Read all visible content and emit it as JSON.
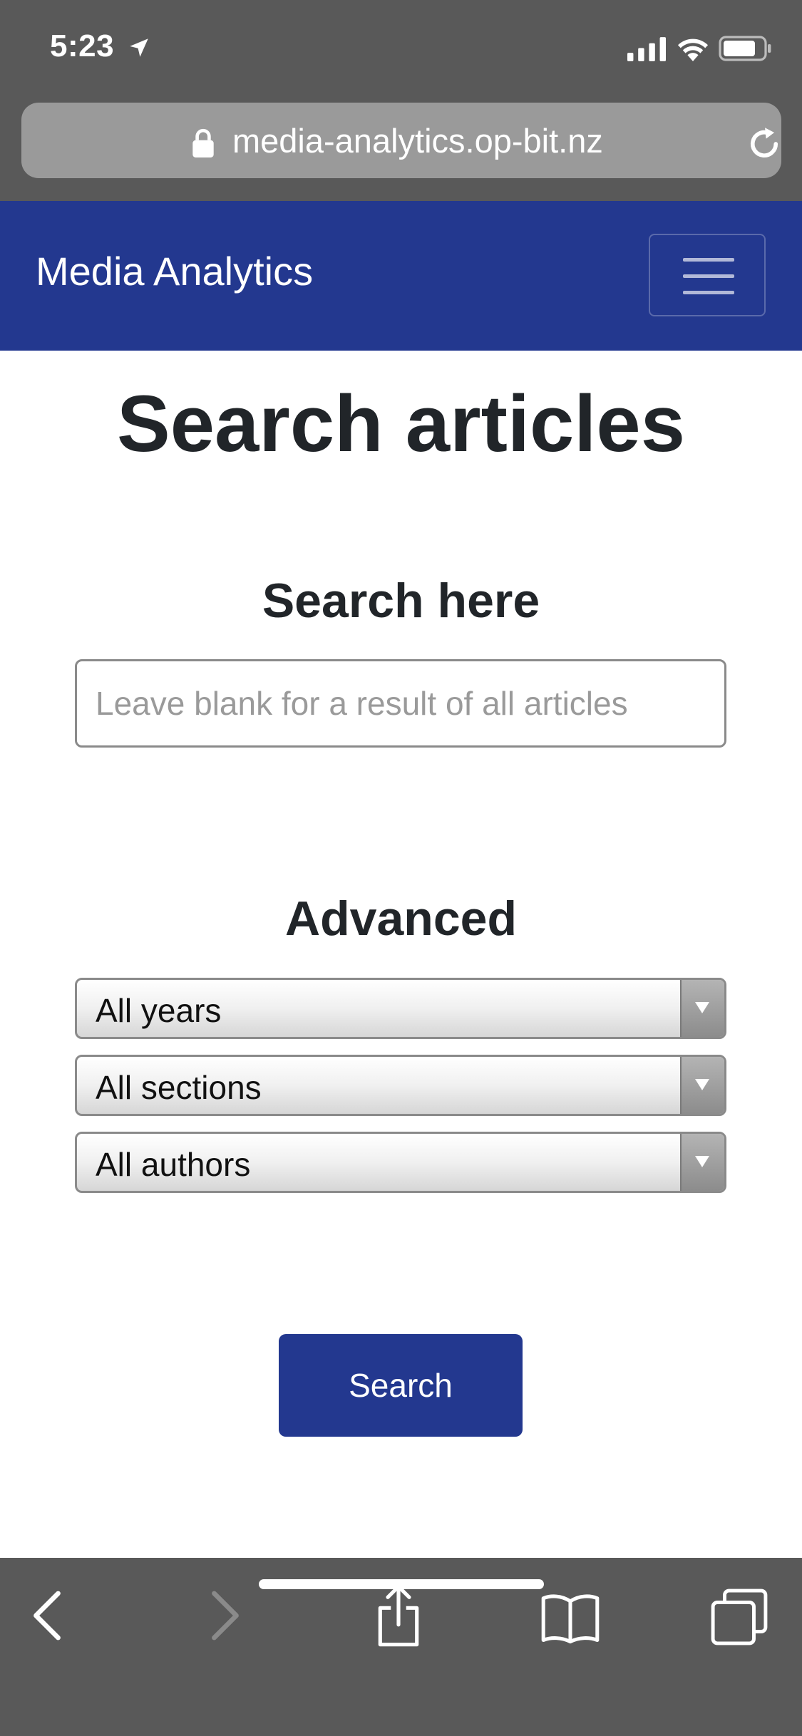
{
  "status_bar": {
    "time": "5:23",
    "icons": [
      "location-arrow-icon",
      "cellular-signal-icon",
      "wifi-icon",
      "battery-icon"
    ]
  },
  "browser": {
    "url": "media-analytics.op-bit.nz",
    "icons": [
      "lock-icon",
      "reload-icon"
    ]
  },
  "navbar": {
    "brand": "Media Analytics",
    "toggler_icon": "hamburger-menu-icon",
    "background_color": "#23388f"
  },
  "main": {
    "title": "Search articles",
    "search": {
      "heading": "Search here",
      "placeholder": "Leave blank for a result of all articles",
      "value": ""
    },
    "advanced": {
      "heading": "Advanced",
      "selects": [
        {
          "name": "years",
          "selected": "All years"
        },
        {
          "name": "sections",
          "selected": "All sections"
        },
        {
          "name": "authors",
          "selected": "All authors"
        }
      ]
    },
    "submit_label": "Search"
  },
  "toolbar": {
    "icons": [
      "back-icon",
      "forward-icon",
      "share-icon",
      "bookmarks-icon",
      "tabs-icon"
    ]
  }
}
